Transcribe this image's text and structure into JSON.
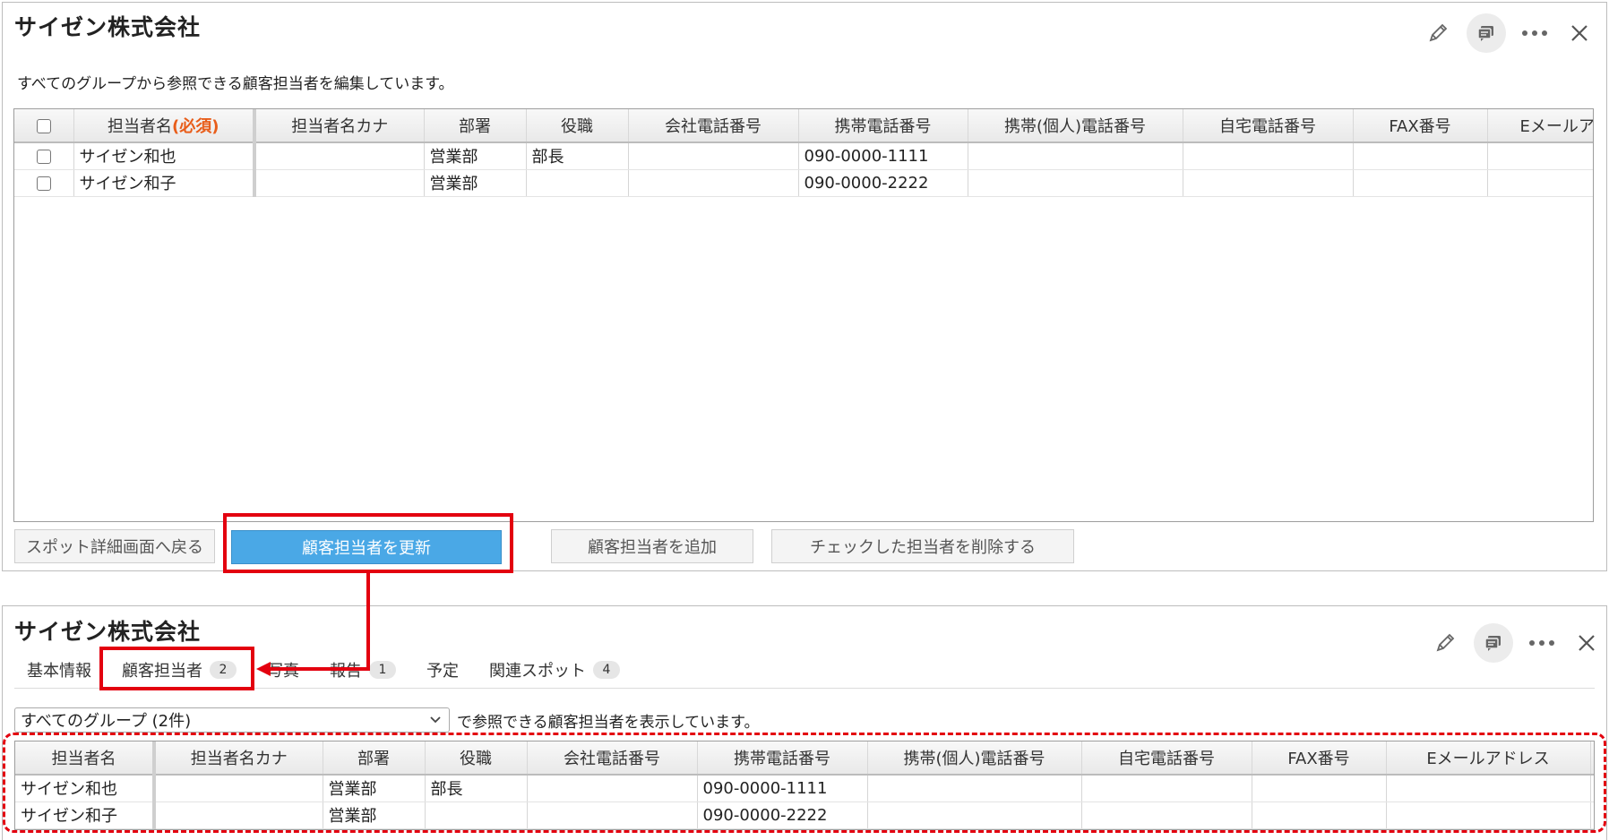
{
  "edit_panel": {
    "title": "サイゼン株式会社",
    "description": "すべてのグループから参照できる顧客担当者を編集しています。",
    "table": {
      "headers": {
        "name": "担当者名",
        "required": "(必須)",
        "kana": "担当者名カナ",
        "dept": "部署",
        "position": "役職",
        "company_phone": "会社電話番号",
        "mobile_phone": "携帯電話番号",
        "personal_mobile": "携帯(個人)電話番号",
        "home_phone": "自宅電話番号",
        "fax": "FAX番号",
        "email": "Eメールア"
      },
      "rows": [
        {
          "name": "サイゼン和也",
          "kana": "",
          "dept": "営業部",
          "position": "部長",
          "company_phone": "",
          "mobile_phone": "090-0000-1111",
          "personal_mobile": "",
          "home_phone": "",
          "fax": "",
          "email": ""
        },
        {
          "name": "サイゼン和子",
          "kana": "",
          "dept": "営業部",
          "position": "",
          "company_phone": "",
          "mobile_phone": "090-0000-2222",
          "personal_mobile": "",
          "home_phone": "",
          "fax": "",
          "email": ""
        }
      ]
    },
    "buttons": {
      "back": "スポット詳細画面へ戻る",
      "update": "顧客担当者を更新",
      "add": "顧客担当者を追加",
      "delete": "チェックした担当者を削除する"
    }
  },
  "view_panel": {
    "title": "サイゼン株式会社",
    "tabs": [
      {
        "label": "基本情報",
        "count": ""
      },
      {
        "label": "顧客担当者",
        "count": "2"
      },
      {
        "label": "写真",
        "count": ""
      },
      {
        "label": "報告",
        "count": "1"
      },
      {
        "label": "予定",
        "count": ""
      },
      {
        "label": "関連スポット",
        "count": "4"
      }
    ],
    "group_select": "すべてのグループ (2件)",
    "group_note": "で参照できる顧客担当者を表示しています。",
    "table": {
      "headers": {
        "name": "担当者名",
        "kana": "担当者名カナ",
        "dept": "部署",
        "position": "役職",
        "company_phone": "会社電話番号",
        "mobile_phone": "携帯電話番号",
        "personal_mobile": "携帯(個人)電話番号",
        "home_phone": "自宅電話番号",
        "fax": "FAX番号",
        "email": "Eメールアドレス"
      },
      "rows": [
        {
          "name": "サイゼン和也",
          "kana": "",
          "dept": "営業部",
          "position": "部長",
          "company_phone": "",
          "mobile_phone": "090-0000-1111",
          "personal_mobile": "",
          "home_phone": "",
          "fax": "",
          "email": ""
        },
        {
          "name": "サイゼン和子",
          "kana": "",
          "dept": "営業部",
          "position": "",
          "company_phone": "",
          "mobile_phone": "090-0000-2222",
          "personal_mobile": "",
          "home_phone": "",
          "fax": "",
          "email": ""
        }
      ]
    }
  },
  "colors": {
    "accent_red": "#e3000f",
    "primary_button": "#4aa8e6",
    "required_text": "#e85d1a"
  },
  "icons": [
    "pencil-icon",
    "comment-icon",
    "more-icon",
    "close-icon"
  ]
}
